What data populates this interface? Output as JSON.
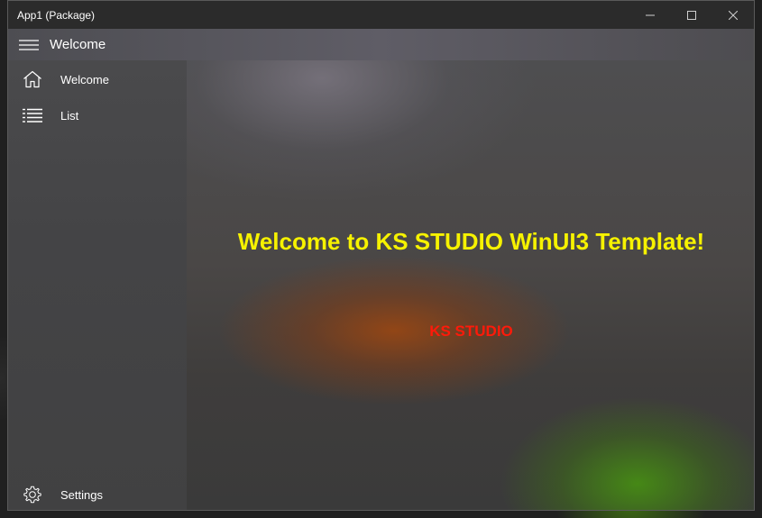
{
  "window": {
    "title": "App1 (Package)"
  },
  "caption_buttons": {
    "minimize_icon": "minimize-icon",
    "maximize_icon": "maximize-icon",
    "close_icon": "close-icon"
  },
  "header": {
    "menu_icon": "hamburger-icon",
    "title": "Welcome"
  },
  "sidebar": {
    "items": [
      {
        "label": "Welcome",
        "icon": "home-icon"
      },
      {
        "label": "List",
        "icon": "list-icon"
      }
    ],
    "footer": {
      "label": "Settings",
      "icon": "gear-icon"
    }
  },
  "main": {
    "heading": "Welcome to KS STUDIO WinUI3 Template!",
    "subtitle": "KS STUDIO"
  },
  "colors": {
    "heading": "#f6f200",
    "subtitle": "#ff1a0a"
  }
}
